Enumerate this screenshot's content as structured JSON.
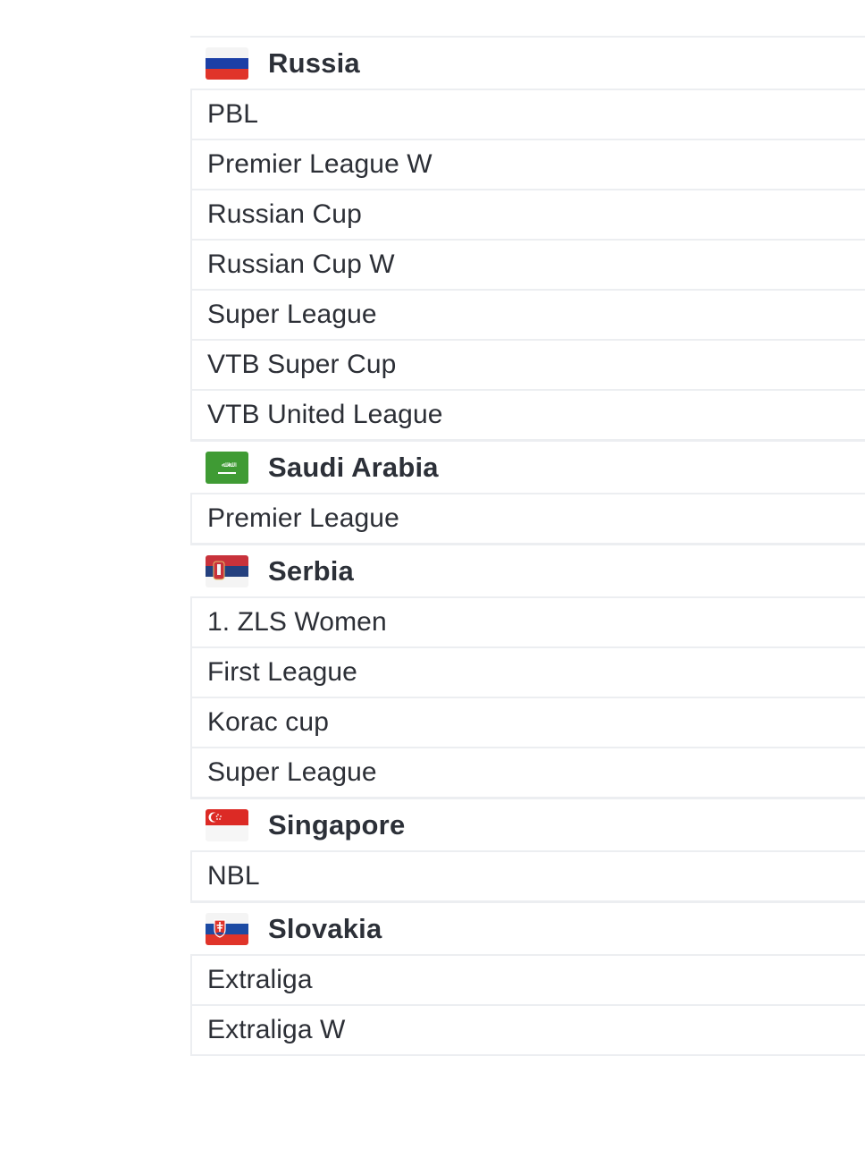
{
  "groups": [
    {
      "country": "Russia",
      "flag": "russia-flag",
      "leagues": [
        "PBL",
        "Premier League W",
        "Russian Cup",
        "Russian Cup W",
        "Super League",
        "VTB Super Cup",
        "VTB United League"
      ]
    },
    {
      "country": "Saudi Arabia",
      "flag": "saudi-arabia-flag",
      "leagues": [
        "Premier League"
      ]
    },
    {
      "country": "Serbia",
      "flag": "serbia-flag",
      "leagues": [
        "1. ZLS Women",
        "First League",
        "Korac cup",
        "Super League"
      ]
    },
    {
      "country": "Singapore",
      "flag": "singapore-flag",
      "leagues": [
        "NBL"
      ]
    },
    {
      "country": "Slovakia",
      "flag": "slovakia-flag",
      "leagues": [
        "Extraliga",
        "Extraliga W"
      ]
    }
  ],
  "colors": {
    "divider": "#eceef1",
    "text": "#2c2f36"
  }
}
